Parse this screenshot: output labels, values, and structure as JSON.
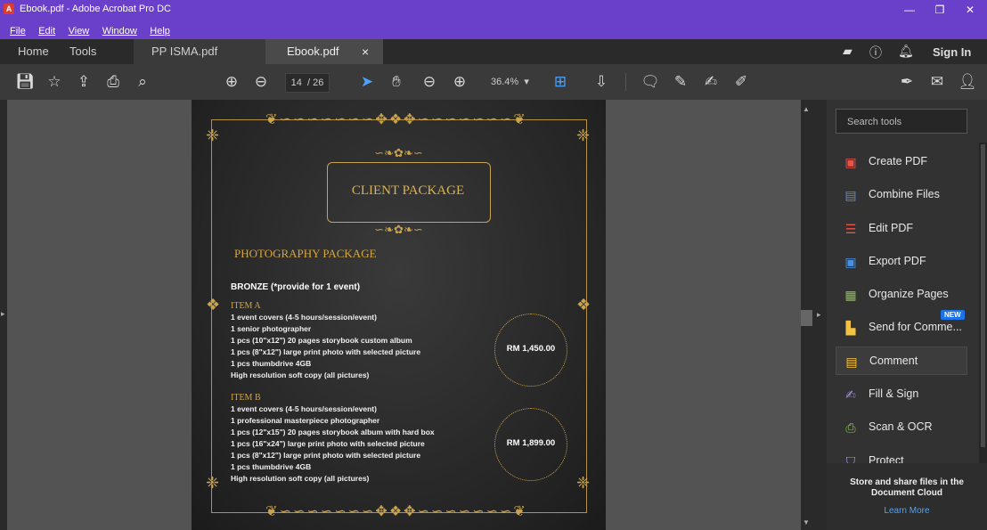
{
  "window": {
    "title": "Ebook.pdf - Adobe Acrobat Pro DC",
    "minimize": "—",
    "restore": "❐",
    "close": "✕",
    "app_icon": "A"
  },
  "menu": [
    "File",
    "Edit",
    "View",
    "Window",
    "Help"
  ],
  "tabs": {
    "home": "Home",
    "tools": "Tools",
    "doc1": "PP ISMA.pdf",
    "doc2": "Ebook.pdf",
    "close": "×"
  },
  "header_right": {
    "sign_in": "Sign In"
  },
  "toolbar": {
    "page_current": "14",
    "page_total": "/ 26",
    "zoom": "36.4%"
  },
  "document": {
    "heading": "CLIENT PACKAGE",
    "package_title": "PHOTOGRAPHY PACKAGE",
    "tier": "BRONZE (*provide for 1 event)",
    "item_a": {
      "title": "ITEM A",
      "lines": [
        "1 event covers (4-5 hours/session/event)",
        "1 senior  photographer",
        "1 pcs (10\"x12\") 20 pages storybook custom album",
        "1 pcs (8\"x12\") large print photo with selected picture",
        "1 pcs thumbdrive 4GB",
        "High resolution soft copy (all pictures)"
      ],
      "price": "RM 1,450.00"
    },
    "item_b": {
      "title": "ITEM B",
      "lines": [
        "1 event covers (4-5 hours/session/event)",
        "1 professional masterpiece photographer",
        "1 pcs (12\"x15\") 20 pages storybook album with hard box",
        "1 pcs (16\"x24\") large print photo with selected picture",
        "1 pcs (8\"x12\") large print photo with selected picture",
        "1 pcs thumbdrive 4GB",
        "High resolution soft copy (all pictures)"
      ],
      "price": "RM 1,899.00"
    }
  },
  "right_panel": {
    "search_placeholder": "Search tools",
    "tools": [
      {
        "label": "Create PDF",
        "icon": "create-pdf-icon",
        "color": "#e8534a"
      },
      {
        "label": "Combine Files",
        "icon": "combine-files-icon",
        "color": "#4a90e2"
      },
      {
        "label": "Edit PDF",
        "icon": "edit-pdf-icon",
        "color": "#e8534a"
      },
      {
        "label": "Export PDF",
        "icon": "export-pdf-icon",
        "color": "#4a90e2"
      },
      {
        "label": "Organize Pages",
        "icon": "organize-pages-icon",
        "color": "#8bc34a"
      },
      {
        "label": "Send for Comme...",
        "icon": "send-for-comment-icon",
        "color": "#f5c342",
        "badge": "NEW"
      },
      {
        "label": "Comment",
        "icon": "comment-icon",
        "color": "#f5c342"
      },
      {
        "label": "Fill & Sign",
        "icon": "fill-sign-icon",
        "color": "#a98de8"
      },
      {
        "label": "Scan & OCR",
        "icon": "scan-ocr-icon",
        "color": "#8bc34a"
      },
      {
        "label": "Protect",
        "icon": "protect-icon",
        "color": "#a98de8"
      }
    ],
    "footer_message": "Store and share files in the Document Cloud",
    "learn_more": "Learn More"
  }
}
